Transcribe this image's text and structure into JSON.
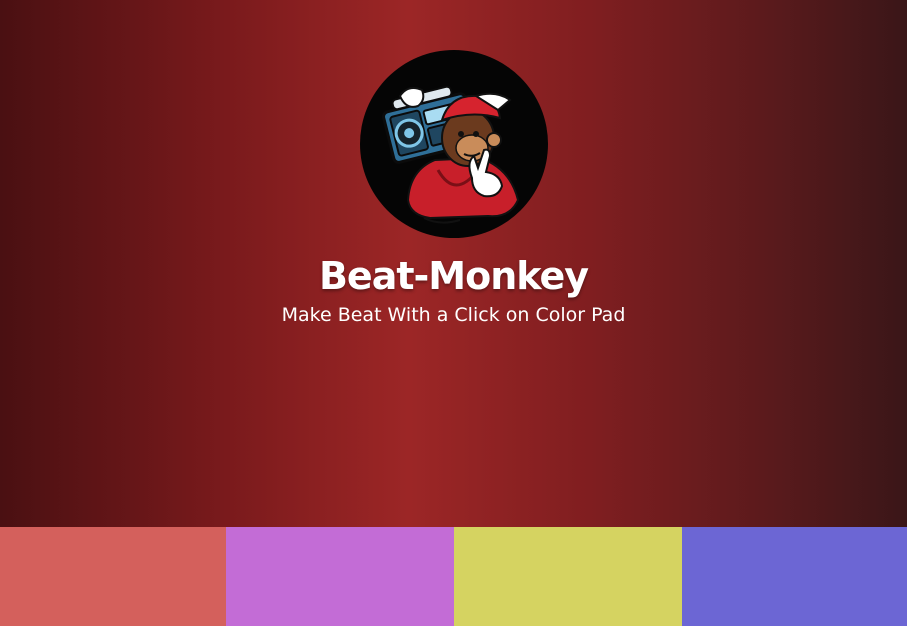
{
  "header": {
    "logo_icon": "monkey-boombox-logo",
    "title": "Beat-Monkey",
    "subtitle": "Make Beat With a Click on Color Pad"
  },
  "pads": [
    {
      "name": "pad-1",
      "color": "#d4605c"
    },
    {
      "name": "pad-2",
      "color": "#c36cd6"
    },
    {
      "name": "pad-3",
      "color": "#d5d361"
    },
    {
      "name": "pad-4",
      "color": "#6c66d4"
    }
  ]
}
